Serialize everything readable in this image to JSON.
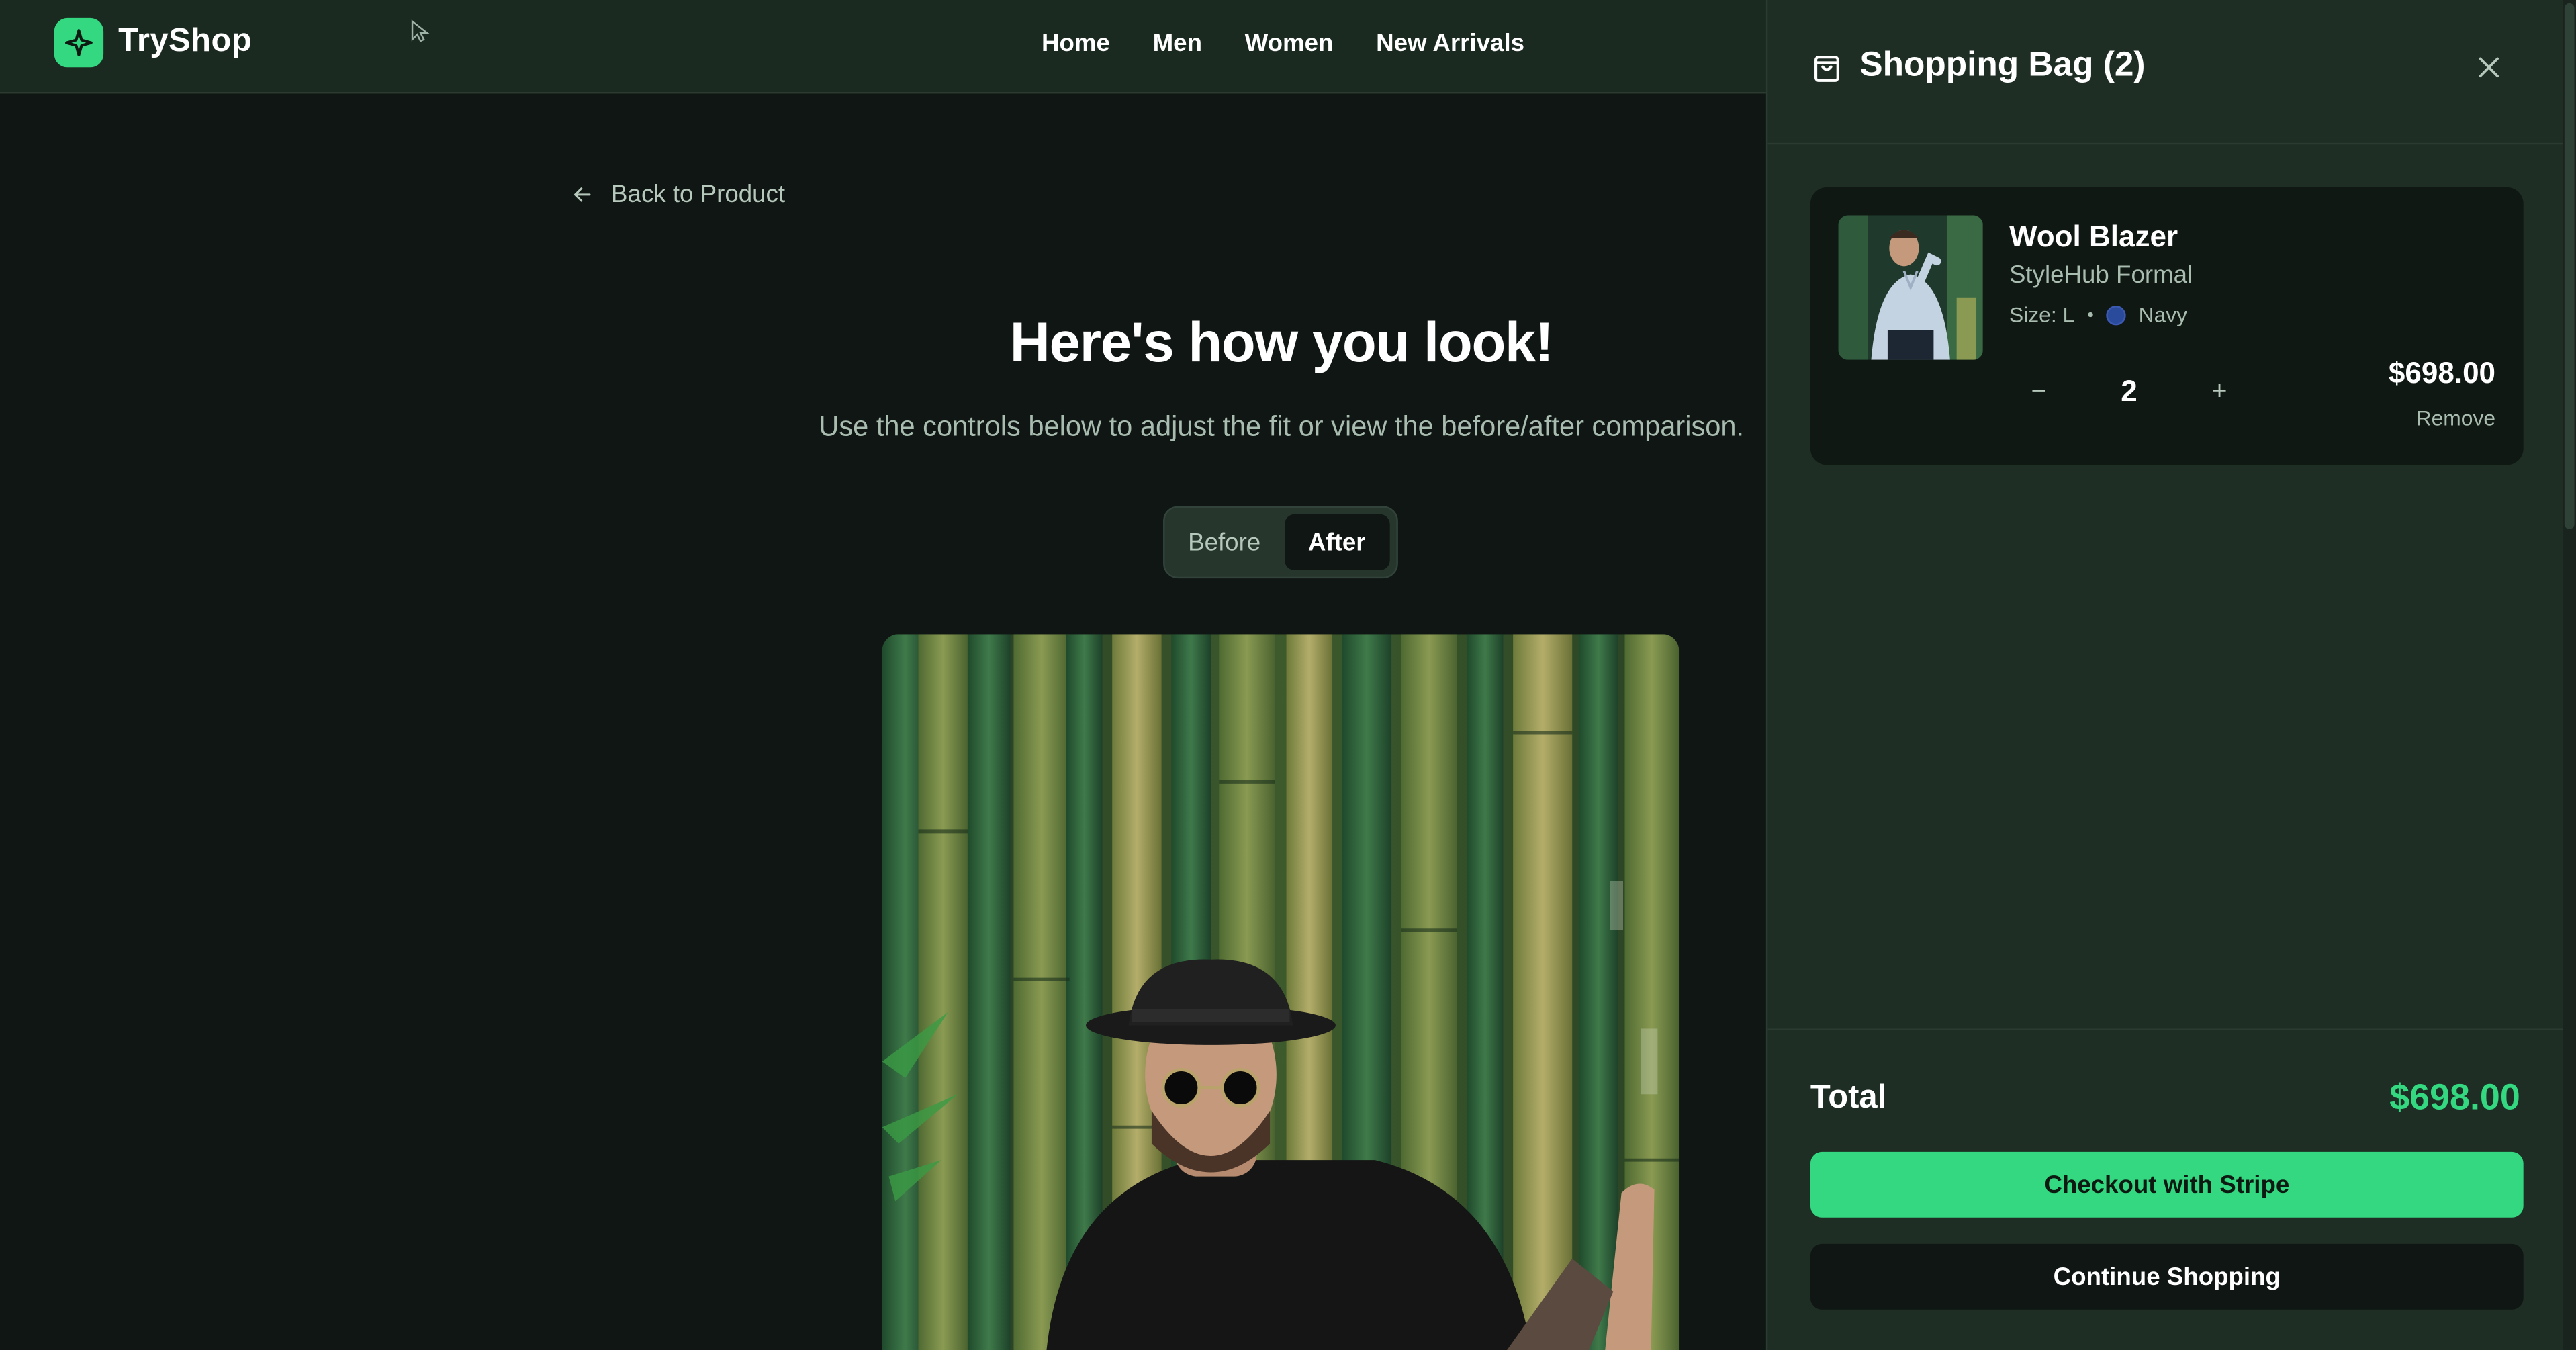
{
  "header": {
    "brand": "TryShop",
    "nav": [
      "Home",
      "Men",
      "Women",
      "New Arrivals"
    ]
  },
  "main": {
    "back_label": "Back to Product",
    "title": "Here's how you look!",
    "subtitle": "Use the controls below to adjust the fit or view the before/after comparison.",
    "toggle": {
      "before": "Before",
      "after": "After",
      "active": "after"
    }
  },
  "cart": {
    "title": "Shopping Bag (2)",
    "items": [
      {
        "name": "Wool Blazer",
        "brand": "StyleHub Formal",
        "size": "Size: L",
        "color_name": "Navy",
        "color_hex": "#2a4a9c",
        "quantity": "2",
        "price": "$698.00",
        "remove_label": "Remove"
      }
    ],
    "total_label": "Total",
    "total_value": "$698.00",
    "checkout_label": "Checkout with Stripe",
    "continue_label": "Continue Shopping"
  },
  "colors": {
    "accent": "#34d880",
    "background": "#0f1613",
    "panel": "#1e2e24"
  }
}
